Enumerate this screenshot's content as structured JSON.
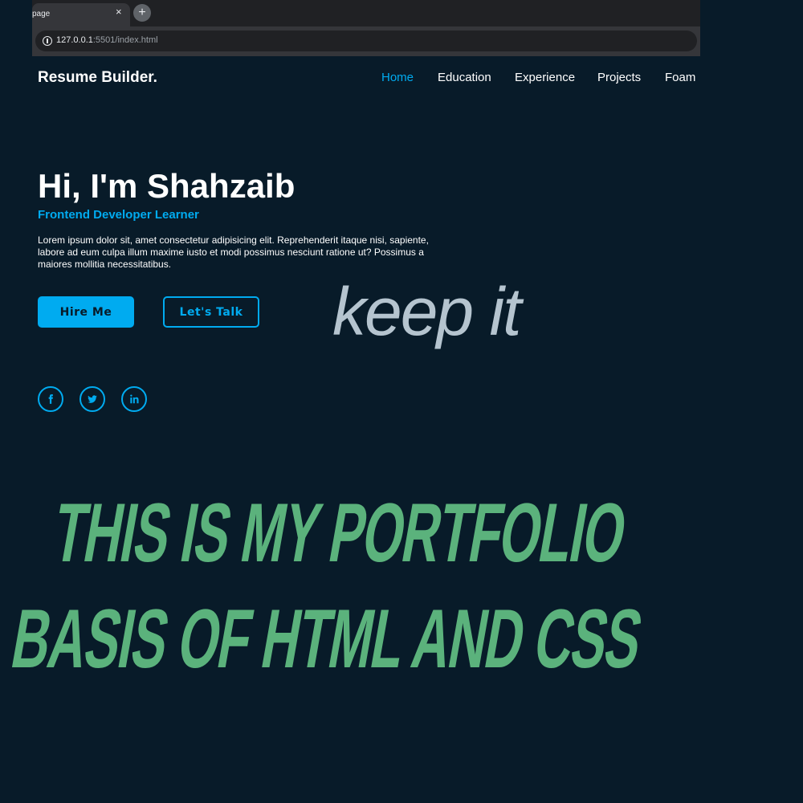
{
  "browser": {
    "tab_title": "page",
    "tab_close": "×",
    "new_tab": "+",
    "url_host": "127.0.0.1",
    "url_path": ":5501/index.html"
  },
  "header": {
    "logo": "Resume Builder.",
    "nav": [
      "Home",
      "Education",
      "Experience",
      "Projects",
      "Foam"
    ],
    "active_nav": "Home"
  },
  "hero": {
    "title": "Hi, I'm Shahzaib",
    "subtitle": "Frontend Developer Learner",
    "description": "Lorem ipsum dolor sit, amet consectetur adipisicing elit. Reprehenderit itaque nisi, sapiente, labore ad eum culpa illum maxime iusto et modi possimus nesciunt ratione ut? Possimus a maiores mollitia necessitatibus.",
    "hire_button": "Hire Me",
    "talk_button": "Let's Talk",
    "social_icons": [
      "facebook-icon",
      "twitter-icon",
      "linkedin-icon"
    ]
  },
  "overlay": {
    "keep_text": "keep it",
    "line1": "THIS IS MY PORTFOLIO",
    "line2": "BASIS OF HTML AND CSS"
  },
  "colors": {
    "background": "#081b29",
    "accent": "#00abf0",
    "overlay_green": "#5bb27c",
    "overlay_gray": "#b5c4cf"
  }
}
